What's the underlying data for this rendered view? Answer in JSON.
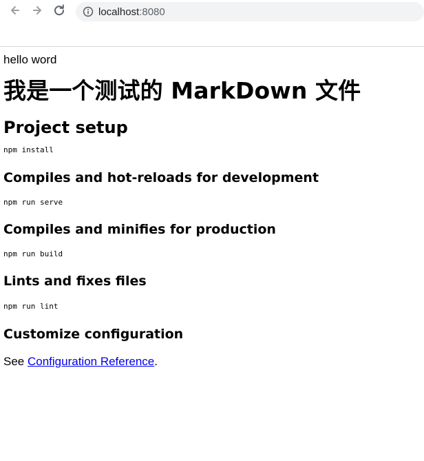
{
  "browser": {
    "address": {
      "host": "localhost",
      "port": ":8080"
    },
    "icons": {
      "back": "arrow-left",
      "forward": "arrow-right",
      "reload": "reload",
      "info": "info-circle"
    }
  },
  "content": {
    "hello": "hello word",
    "title": "我是一个测试的 MarkDown 文件",
    "setup_heading": "Project setup",
    "sections": [
      {
        "command": "npm install"
      },
      {
        "heading": "Compiles and hot-reloads for development",
        "command": "npm run serve"
      },
      {
        "heading": "Compiles and minifies for production",
        "command": "npm run build"
      },
      {
        "heading": "Lints and fixes files",
        "command": "npm run lint"
      }
    ],
    "customize_heading": "Customize configuration",
    "see_text": "See ",
    "link_text": "Configuration Reference",
    "period": "."
  },
  "colors": {
    "link": "#0000ee",
    "address_bar": "#f1f3f4",
    "icon": "#5f6368"
  }
}
